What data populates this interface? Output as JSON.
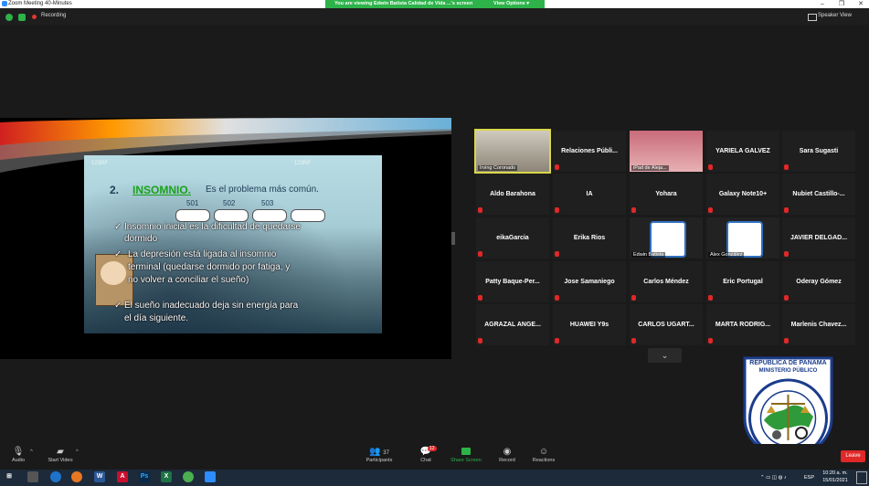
{
  "window": {
    "title": "Zoom Meeting 40-Minutes"
  },
  "banner": {
    "message": "You are viewing Edwin Batista Calidad de Vida ...'s screen",
    "view_options": "View Options"
  },
  "topbar": {
    "recording": "Recording",
    "speaker_view": "Speaker View"
  },
  "slide": {
    "number": "2.",
    "title": "INSOMNIO.",
    "subtitle": "Es el problema más común.",
    "sheep_numbers": [
      "501",
      "502",
      "503"
    ],
    "lines": [
      "Insomnio inicial es la dificultad de quedarse",
      "dormido",
      "La depresión está ligada al insomnio",
      "terminal (quedarse dormido por fatiga, y",
      "no volver a conciliar el sueño)",
      "El sueño inadecuado deja sin energía para",
      "el día siguiente."
    ],
    "watermark": "123RF"
  },
  "gallery": {
    "tiles": [
      {
        "name": "Irving Coronado",
        "type": "video"
      },
      {
        "name": "Relaciones  Públi...",
        "type": "name"
      },
      {
        "name": "iPad de Alejа...",
        "type": "video"
      },
      {
        "name": "YARIELA GALVEZ",
        "type": "name"
      },
      {
        "name": "Sara Sugasti",
        "type": "name"
      },
      {
        "name": "Aldo Barahona",
        "type": "name"
      },
      {
        "name": "IA",
        "type": "name"
      },
      {
        "name": "Yohara",
        "type": "name"
      },
      {
        "name": "Galaxy Note10+",
        "type": "name"
      },
      {
        "name": "Nubiet  Castillo-...",
        "type": "name"
      },
      {
        "name": "eikaGarcia",
        "type": "name"
      },
      {
        "name": "Erika Rios",
        "type": "name"
      },
      {
        "name": "Edwin Batista",
        "type": "video"
      },
      {
        "name": "Alex González",
        "type": "video"
      },
      {
        "name": "JAVIER DELGAD...",
        "type": "name"
      },
      {
        "name": "Patty  Baque-Per...",
        "type": "name"
      },
      {
        "name": "Jose Samaniego",
        "type": "name"
      },
      {
        "name": "Carlos Méndez",
        "type": "name"
      },
      {
        "name": "Eric Portugal",
        "type": "name"
      },
      {
        "name": "Oderay Gómez",
        "type": "name"
      },
      {
        "name": "AGRAZAL ANGE...",
        "type": "name"
      },
      {
        "name": "HUAWEI Y9s",
        "type": "name"
      },
      {
        "name": "CARLOS UGART...",
        "type": "name"
      },
      {
        "name": "MARTA  RODRIG...",
        "type": "name"
      },
      {
        "name": "Marlenis  Chavez...",
        "type": "name"
      }
    ]
  },
  "toolbar": {
    "audio": "Audio",
    "start_video": "Start Video",
    "participants": "Participants",
    "participants_count": "37",
    "chat": "Chat",
    "chat_badge": "12",
    "share_screen": "Share Screen",
    "record": "Record",
    "reactions": "Reactions",
    "leave": "Leave"
  },
  "seal": {
    "line1": "REPÚBLICA DE PANAMÁ",
    "line2": "MINISTERIO PÚBLICO",
    "ring_text": "INSTITUTO DE MEDICINA LEGAL Y CIENCIAS FORENSES"
  },
  "taskbar": {
    "time": "10:20 a. m.",
    "date": "15/01/2021",
    "lang": "ESP"
  },
  "colors": {
    "accent_green": "#2db34a",
    "leave_red": "#e02828",
    "zoom_blue": "#2d8cff",
    "active_speaker": "#d9d84a"
  }
}
